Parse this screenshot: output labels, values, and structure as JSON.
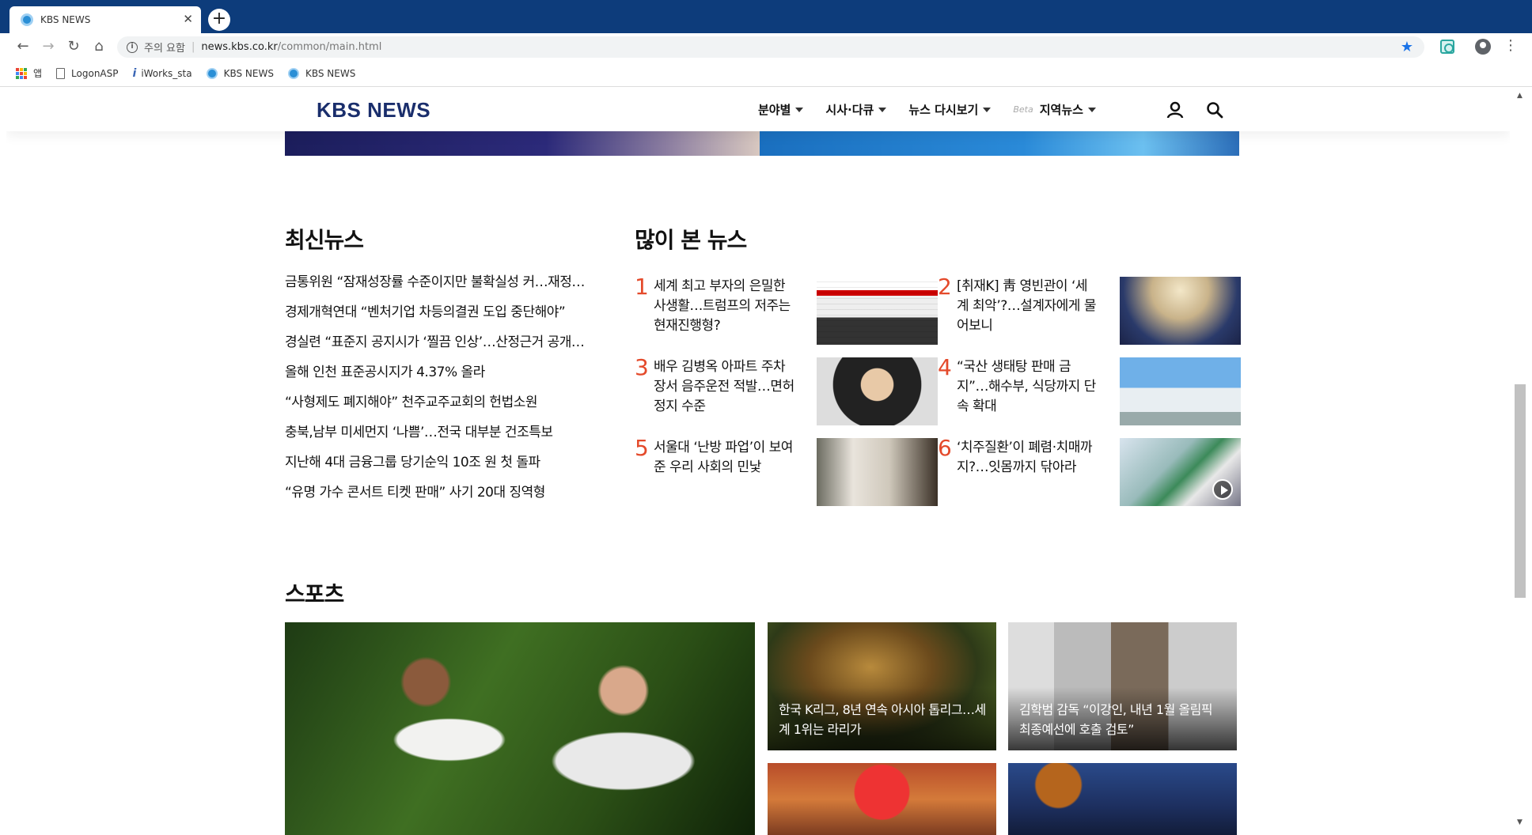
{
  "browser": {
    "tab_title": "KBS NEWS",
    "security_label": "주의 요함",
    "url_host": "news.kbs.co.kr",
    "url_path": "/common/main.html",
    "bookmarks": [
      "앱",
      "LogonASP",
      "iWorks_sta",
      "KBS NEWS",
      "KBS NEWS"
    ]
  },
  "site": {
    "logo": "KBS NEWS",
    "nav": {
      "sections": "분야별",
      "current_affairs": "시사·다큐",
      "replay": "뉴스 다시보기",
      "beta": "Beta",
      "regional": "지역뉴스"
    }
  },
  "latest": {
    "title": "최신뉴스",
    "items": [
      "금통위원 “잠재성장률 수준이지만 불확실성 커…재정…",
      "경제개혁연대 “벤처기업 차등의결권 도입 중단해야”",
      "경실련 “표준지 공지시가 ‘찔끔 인상’…산정근거 공개…",
      "올해 인천 표준공시지가 4.37% 올라",
      "“사형제도 폐지해야” 천주교주교회의 헌법소원",
      "충북,남부 미세먼지 ‘나쁨’…전국 대부분 건조특보",
      "지난해 4대 금융그룹 당기순익 10조 원 첫 돌파",
      "“유명 가수 콘서트 티켓 판매” 사기 20대 징역형"
    ]
  },
  "popular": {
    "title": "많이 본 뉴스",
    "items": [
      {
        "rank": "1",
        "text": "세계 최고 부자의 은밀한 사생활…트럼프의 저주는 현재진행형?"
      },
      {
        "rank": "2",
        "text": "[취재K] 靑 영빈관이 ‘세계 최악’?…설계자에게 물어보니"
      },
      {
        "rank": "3",
        "text": "배우 김병옥 아파트 주차장서 음주운전 적발…면허정지 수준"
      },
      {
        "rank": "4",
        "text": "“국산 생태탕 판매 금지”…해수부, 식당까지 단속 확대"
      },
      {
        "rank": "5",
        "text": "서울대 ‘난방 파업’이 보여준 우리 사회의 민낯"
      },
      {
        "rank": "6",
        "text": "‘치주질환’이 폐렴·치매까지?…잇몸까지 닦아라"
      }
    ]
  },
  "sports": {
    "title": "스포츠",
    "cards": [
      {
        "caption": "한국 K리그, 8년 연속 아시아 톱리그…세계 1위는 라리가"
      },
      {
        "caption": "김학범 감독 “이강인, 내년 1월 올림픽 최종예선에 호출 검토”"
      }
    ]
  }
}
